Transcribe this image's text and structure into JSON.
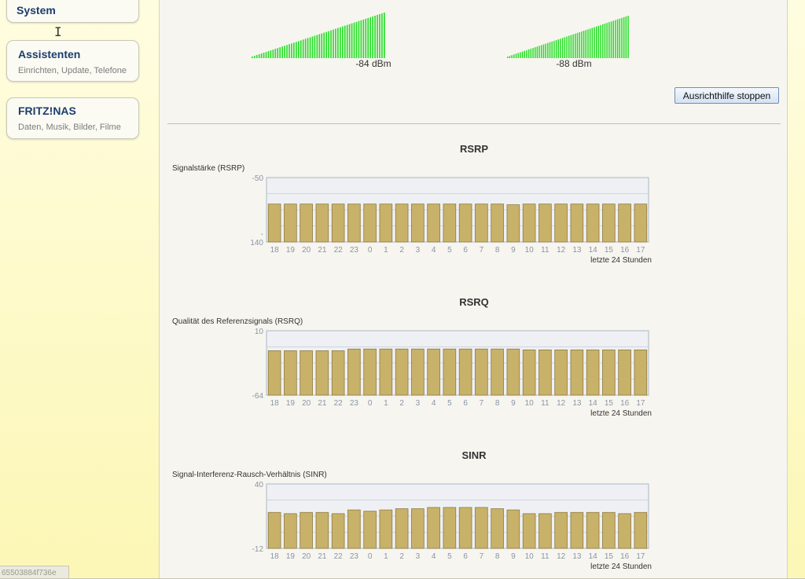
{
  "nav": {
    "system": {
      "title": "System"
    },
    "assistants": {
      "title": "Assistenten",
      "subtitle": "Einrichten, Update, Telefone"
    },
    "nas": {
      "title": "FRITZ!NAS",
      "subtitle": "Daten, Musik, Bilder, Filme"
    }
  },
  "status_hash": "65503884f736e",
  "meters": [
    {
      "label": "-84 dBm",
      "color": "#22dd22"
    },
    {
      "label": "-88 dBm",
      "color": "#22dd22"
    }
  ],
  "stop_button_label": "Ausrichthilfe stoppen",
  "bar_color": "#c8b26a",
  "charts": [
    {
      "title": "RSRP",
      "subtitle": "Signalstärke (RSRP)",
      "chart_data": {
        "type": "bar",
        "categories": [
          "18",
          "19",
          "20",
          "21",
          "22",
          "23",
          "0",
          "1",
          "2",
          "3",
          "4",
          "5",
          "6",
          "7",
          "8",
          "9",
          "10",
          "11",
          "12",
          "13",
          "14",
          "15",
          "16",
          "17"
        ],
        "values": [
          -87,
          -87,
          -87,
          -87,
          -87,
          -87,
          -87,
          -87,
          -87,
          -87,
          -87,
          -87,
          -87,
          -87,
          -87,
          -88,
          -87,
          -87,
          -87,
          -87,
          -87,
          -87,
          -87,
          -87
        ],
        "ylim": [
          -140,
          -50
        ],
        "ytick_labels": [
          "-50",
          "-\n140"
        ],
        "xlabel": "letzte 24 Stunden"
      }
    },
    {
      "title": "RSRQ",
      "subtitle": "Qualität des Referenzsignals (RSRQ)",
      "chart_data": {
        "type": "bar",
        "categories": [
          "18",
          "19",
          "20",
          "21",
          "22",
          "23",
          "0",
          "1",
          "2",
          "3",
          "4",
          "5",
          "6",
          "7",
          "8",
          "9",
          "10",
          "11",
          "12",
          "13",
          "14",
          "15",
          "16",
          "17"
        ],
        "values": [
          -13,
          -13,
          -13,
          -13,
          -13,
          -11,
          -11,
          -11,
          -11,
          -11,
          -11,
          -11,
          -11,
          -11,
          -11,
          -11,
          -12,
          -12,
          -12,
          -12,
          -12,
          -12,
          -12,
          -12
        ],
        "ylim": [
          -64,
          10
        ],
        "ytick_labels": [
          "10",
          "-64"
        ],
        "xlabel": "letzte 24 Stunden"
      }
    },
    {
      "title": "SINR",
      "subtitle": "Signal-Interferenz-Rausch-Verhältnis (SINR)",
      "chart_data": {
        "type": "bar",
        "categories": [
          "18",
          "19",
          "20",
          "21",
          "22",
          "23",
          "0",
          "1",
          "2",
          "3",
          "4",
          "5",
          "6",
          "7",
          "8",
          "9",
          "10",
          "11",
          "12",
          "13",
          "14",
          "15",
          "16",
          "17"
        ],
        "values": [
          17,
          16,
          17,
          17,
          16,
          19,
          18,
          19,
          20,
          20,
          21,
          21,
          21,
          21,
          20,
          19,
          16,
          16,
          17,
          17,
          17,
          17,
          16,
          17
        ],
        "ylim": [
          -12,
          40
        ],
        "ytick_labels": [
          "40",
          "-12"
        ],
        "xlabel": "letzte 24 Stunden"
      }
    }
  ]
}
